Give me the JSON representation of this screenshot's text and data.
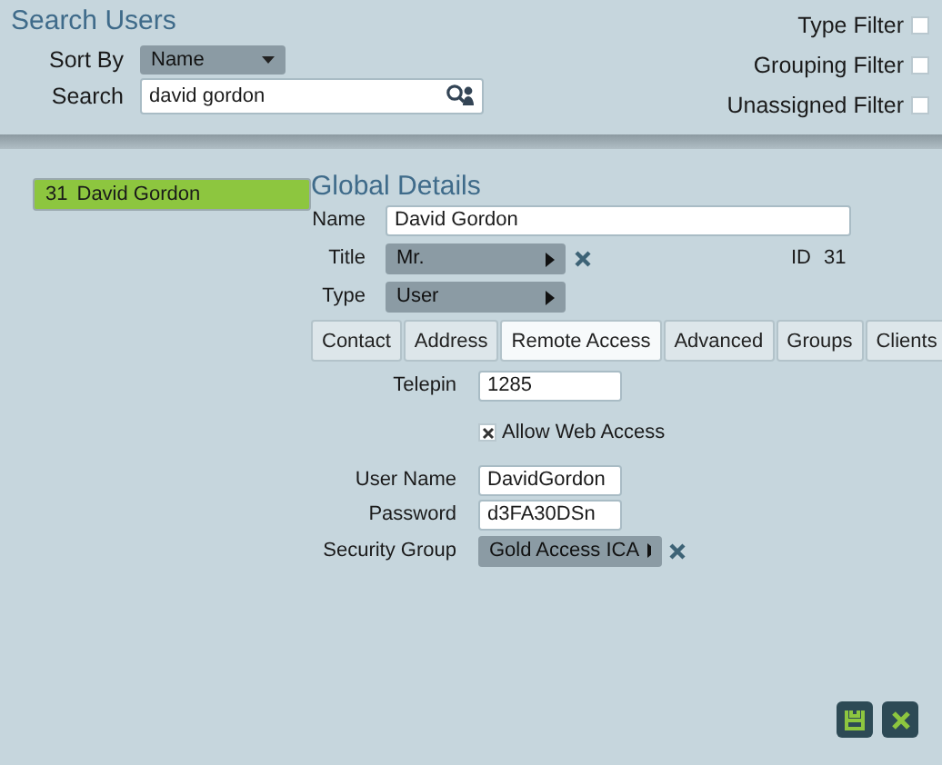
{
  "header": {
    "title": "Search Users",
    "sort_by": {
      "label": "Sort By",
      "value": "Name"
    },
    "search": {
      "label": "Search",
      "value": "david gordon"
    }
  },
  "filters": [
    {
      "label": "Type Filter",
      "checked": false
    },
    {
      "label": "Grouping Filter",
      "checked": false
    },
    {
      "label": "Unassigned Filter",
      "checked": false
    }
  ],
  "results": [
    {
      "id": "31",
      "name": "David Gordon",
      "selected": true
    }
  ],
  "details": {
    "title": "Global Details",
    "name": {
      "label": "Name",
      "value": "David Gordon"
    },
    "title_field": {
      "label": "Title",
      "value": "Mr."
    },
    "id": {
      "label": "ID",
      "value": "31"
    },
    "type": {
      "label": "Type",
      "value": "User"
    },
    "tabs": [
      {
        "label": "Contact",
        "selected": false
      },
      {
        "label": "Address",
        "selected": false
      },
      {
        "label": "Remote Access",
        "selected": true
      },
      {
        "label": "Advanced",
        "selected": false
      },
      {
        "label": "Groups",
        "selected": false
      },
      {
        "label": "Clients",
        "selected": false
      }
    ],
    "remote_access": {
      "telepin": {
        "label": "Telepin",
        "value": "1285"
      },
      "allow_web_access": {
        "label": "Allow Web Access",
        "checked": true
      },
      "user_name": {
        "label": "User Name",
        "value": "DavidGordon"
      },
      "password": {
        "label": "Password",
        "value": "d3FA30DSn"
      },
      "security_group": {
        "label": "Security Group",
        "value": "Gold Access ICA"
      }
    }
  }
}
